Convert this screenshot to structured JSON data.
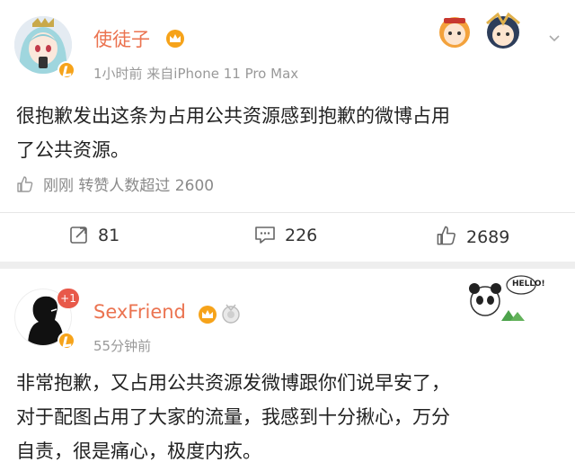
{
  "post1": {
    "username": "使徒子",
    "meta": "1小时前  来自iPhone 11 Pro Max",
    "text_lines": [
      "很抱歉发出这条为占用公共资源感到抱歉的微博占用",
      "了公共资源。"
    ],
    "likes_line": "刚刚 转赞人数超过 2600",
    "repost_count": "81",
    "comment_count": "226",
    "like_count": "2689"
  },
  "post2": {
    "username": "SexFriend",
    "meta": "55分钟前",
    "avatar_badge": "+1",
    "sticker_text": "HELLO!",
    "text_lines": [
      "非常抱歉，又占用公共资源发微博跟你们说早安了，",
      "对于配图占用了大家的流量，我感到十分揪心，万分",
      "自责，很是痛心，极度内疚。"
    ]
  },
  "colors": {
    "username": "#eb7350",
    "meta": "#999999",
    "vip_badge": "#f6a31a",
    "background": "#eeeeee"
  }
}
